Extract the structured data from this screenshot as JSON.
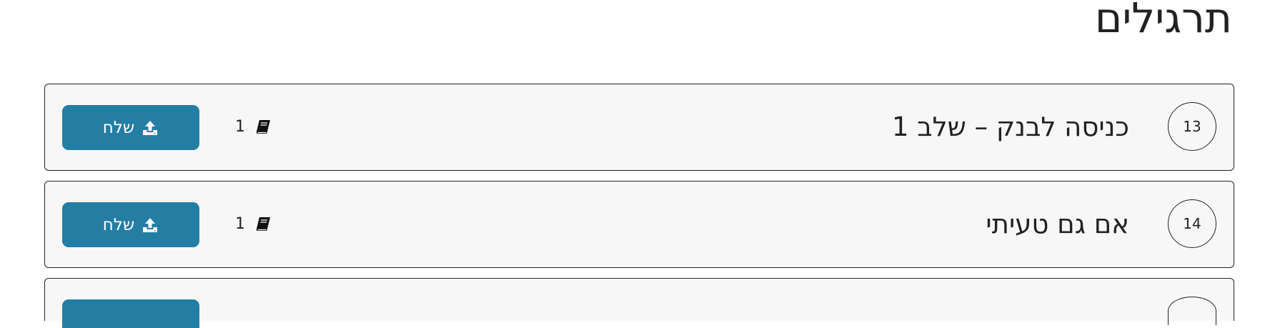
{
  "page": {
    "title": "תרגילים"
  },
  "exercises": [
    {
      "number": "13",
      "name": "כניסה לבנק – שלב 1",
      "solved_count": "1",
      "send_label": "שלח"
    },
    {
      "number": "14",
      "name": "אם גם טעיתי",
      "solved_count": "1",
      "send_label": "שלח"
    }
  ],
  "icons": {
    "solved": "book-icon",
    "send": "upload-icon"
  },
  "colors": {
    "send_button_bg": "#247ea3",
    "send_button_text": "#ffffff",
    "row_bg": "#f7f7f7",
    "border": "#222222"
  }
}
